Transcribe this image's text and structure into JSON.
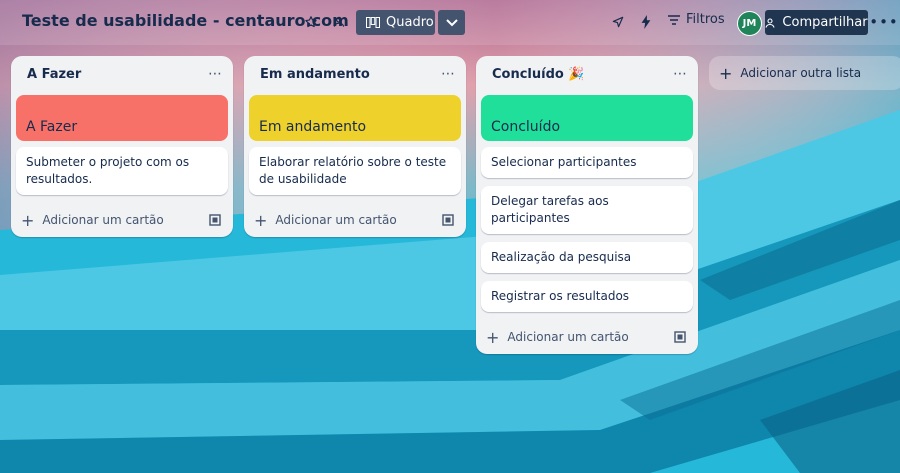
{
  "header": {
    "title": "Teste de usabilidade - centauro.com",
    "view_label": "Quadro",
    "filters_label": "Filtros",
    "avatar_initials": "JM",
    "share_label": "Compartilhar"
  },
  "lists": [
    {
      "title": "A Fazer",
      "cover_label": "A Fazer",
      "cover_color": "#f87168",
      "cards": [
        "Submeter o projeto com os resultados."
      ],
      "add_card_label": "Adicionar um cartão"
    },
    {
      "title": "Em andamento",
      "cover_label": "Em andamento",
      "cover_color": "#eed12b",
      "cards": [
        "Elaborar relatório sobre o teste de usabilidade"
      ],
      "add_card_label": "Adicionar um cartão"
    },
    {
      "title": "Concluído 🎉",
      "cover_label": "Concluído",
      "cover_color": "#1fdf9a",
      "cards": [
        "Selecionar participantes",
        "Delegar tarefas aos participantes",
        "Realização da pesquisa",
        "Registrar os resultados"
      ],
      "add_card_label": "Adicionar um cartão"
    }
  ],
  "add_list_label": "Adicionar outra lista",
  "colors": {
    "primary_button": "#44546f",
    "share_button": "#1f3550",
    "avatar": "#1f845a"
  }
}
